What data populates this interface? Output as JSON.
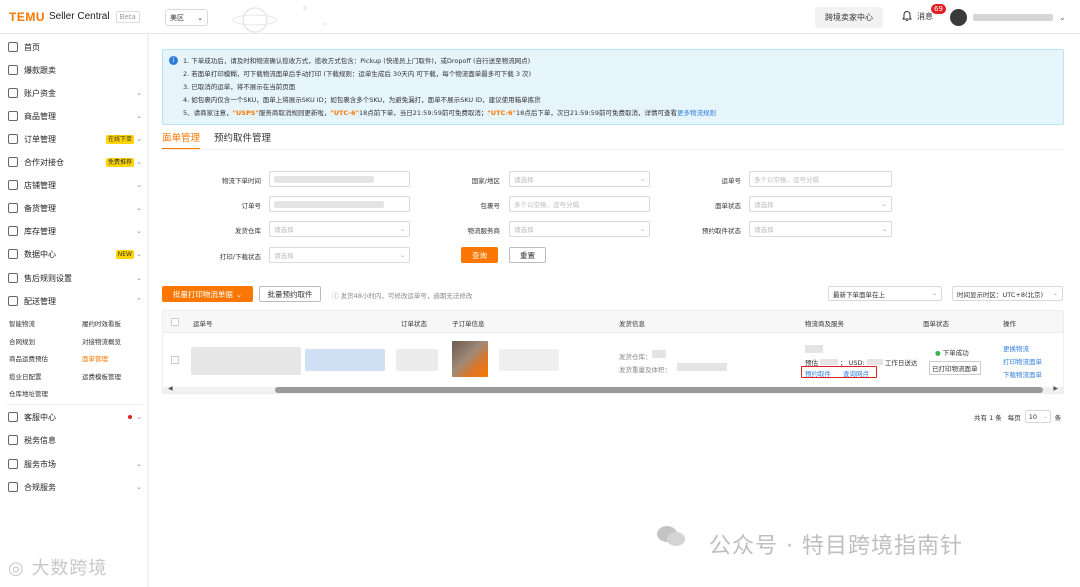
{
  "header": {
    "logo_brand": "TEMU",
    "logo_product": "Seller Central",
    "beta": "Beta",
    "region": "美区",
    "cross_border_btn": "跨境卖家中心",
    "messages_label": "消息",
    "messages_badge": "69"
  },
  "sidebar": {
    "items": [
      {
        "label": "首页"
      },
      {
        "label": "爆款跟卖"
      },
      {
        "label": "账户资金"
      },
      {
        "label": "商品管理"
      },
      {
        "label": "订单管理",
        "badge": "在线下单"
      },
      {
        "label": "合作对接仓",
        "badge": "免费推荐"
      },
      {
        "label": "店铺管理"
      },
      {
        "label": "备货管理"
      },
      {
        "label": "库存管理"
      },
      {
        "label": "数据中心",
        "badge": "NEW"
      },
      {
        "label": "售后规则设置"
      },
      {
        "label": "配送管理"
      },
      {
        "label": "客服中心"
      },
      {
        "label": "税务信息"
      },
      {
        "label": "服务市场"
      },
      {
        "label": "合规服务"
      }
    ],
    "sub_items": [
      "智能物流",
      "履约时效看板",
      "合网规划",
      "对接物流概览",
      "商品运费预估",
      "面单管理",
      "揽业日配置",
      "运费模板管理",
      "仓库地址管理"
    ]
  },
  "notice": {
    "line1": "1. 下单成功后，请及时和物流确认揽收方式，揽收方式包含：Pickup (快递员上门取件)，或Dropoff (自行送至物流网点)",
    "line2": "2. 若面单打印模糊，可下载物流面单后手动打印 (下载规则：运单生成后 30天内 可下载，每个物流面单最多可下载 3 次)",
    "line3": "3. 已取消的运单，将不展示在当前页面",
    "line4": "4. 如包裹内仅含一个SKU，面单上将展示SKU ID；如包裹含多个SKU，为避免漏打，面单不展示SKU ID，建议使用箱单拣货",
    "line5_a": "5、请商家注意，",
    "line5_usps": "\"USPS\"",
    "line5_b": "服务商取消规则更新啦，",
    "line5_utc1": "\"UTC-6\"",
    "line5_c": "18点前下单，当日21:59:59前可免费取消；",
    "line5_utc2": "\"UTC-6\"",
    "line5_d": "18点后下单，次日21:59:59前可免费取消，详情可查看",
    "line5_link": "更多物流规则"
  },
  "tabs": [
    {
      "label": "面单管理"
    },
    {
      "label": "预约取件管理"
    }
  ],
  "filters": {
    "ship_time_label": "物流下单时间",
    "order_no_label": "订单号",
    "warehouse_label": "发货仓库",
    "print_status_label": "打印/下载状态",
    "country_label": "国家/地区",
    "package_no_label": "包裹号",
    "provider_label": "物流服务商",
    "tracking_label": "运单号",
    "label_status_label": "面单状态",
    "pickup_status_label": "预约取件状态",
    "placeholder_select": "请选择",
    "placeholder_multi_pkg": "多个以空格，逗号分隔",
    "placeholder_multi_tracking": "多个以空格，逗号分隔",
    "search_btn": "查询",
    "reset_btn": "重置"
  },
  "toolbar": {
    "batch_print": "批量打印物流单据",
    "batch_pickup": "批量预约取件",
    "hint": "发货48小时内，可修改运单号，逾期无法修改",
    "sort": "最新下单面单在上",
    "timezone": "时间显示时区：UTC+8(北京)"
  },
  "table": {
    "headers": [
      "运单号",
      "订单状态",
      "子订单信息",
      "发货信息",
      "物流商及服务",
      "面单状态",
      "操作"
    ],
    "row": {
      "ship_warehouse_label": "发货仓库：",
      "ship_weight_label": "发货重量及体积：",
      "estimate_prefix": "预估",
      "estimate_currency": "USD",
      "estimate_suffix": "工作日送达",
      "pickup_link": "预约取件",
      "query_link": "查询网点",
      "status": "下单成功",
      "print_status": "已打印物流面单",
      "actions": [
        "更换物流",
        "打印物流面单",
        "下载物流面单"
      ]
    }
  },
  "pagination": {
    "total": "共有 1 条",
    "per_page_label": "每页",
    "per_page_value": "10",
    "unit": "条"
  },
  "watermarks": {
    "right": "公众号 · 特目跨境指南针",
    "left": "大数跨境"
  }
}
